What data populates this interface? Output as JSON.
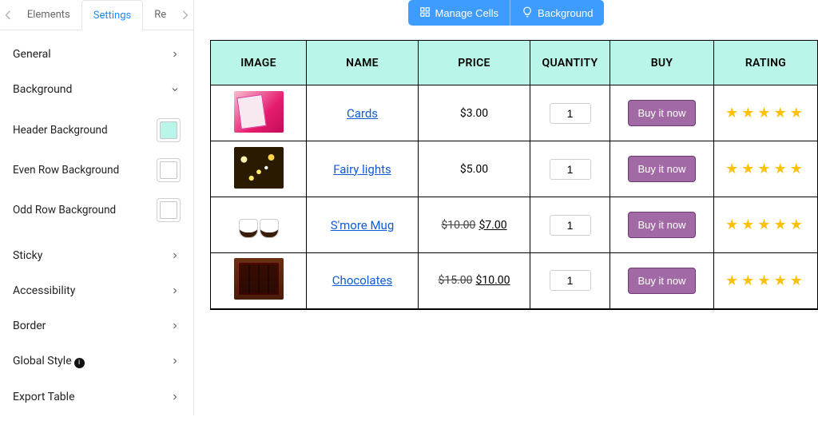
{
  "sidebar": {
    "tabs": {
      "elements": "Elements",
      "settings": "Settings",
      "re": "Re"
    },
    "sections": {
      "general": "General",
      "background": "Background",
      "sticky": "Sticky",
      "accessibility": "Accessibility",
      "border": "Border",
      "global_style": "Global Style",
      "export_table": "Export Table"
    },
    "bg": {
      "header_label": "Header Background",
      "header_color": "#b9f5e8",
      "even_label": "Even Row Background",
      "even_color": "#ffffff",
      "odd_label": "Odd Row Background",
      "odd_color": "#ffffff"
    }
  },
  "toolbar": {
    "manage_cells": "Manage Cells",
    "background": "Background"
  },
  "table": {
    "headers": {
      "image": "IMAGE",
      "name": "NAME",
      "price": "PRICE",
      "quantity": "QUANTITY",
      "buy": "BUY",
      "rating": "RATING"
    },
    "buy_label": "Buy it now",
    "rows": [
      {
        "name": "Cards",
        "price": "$3.00",
        "orig": "",
        "qty": "1",
        "rating": 5,
        "thumb": "card"
      },
      {
        "name": "Fairy lights",
        "price": "$5.00",
        "orig": "",
        "qty": "1",
        "rating": 5,
        "thumb": "lights"
      },
      {
        "name": "S'more Mug",
        "price": "$7.00",
        "orig": "$10.00",
        "qty": "1",
        "rating": 5,
        "thumb": "mug"
      },
      {
        "name": "Chocolates",
        "price": "$10.00",
        "orig": "$15.00",
        "qty": "1",
        "rating": 5,
        "thumb": "choc"
      }
    ]
  }
}
